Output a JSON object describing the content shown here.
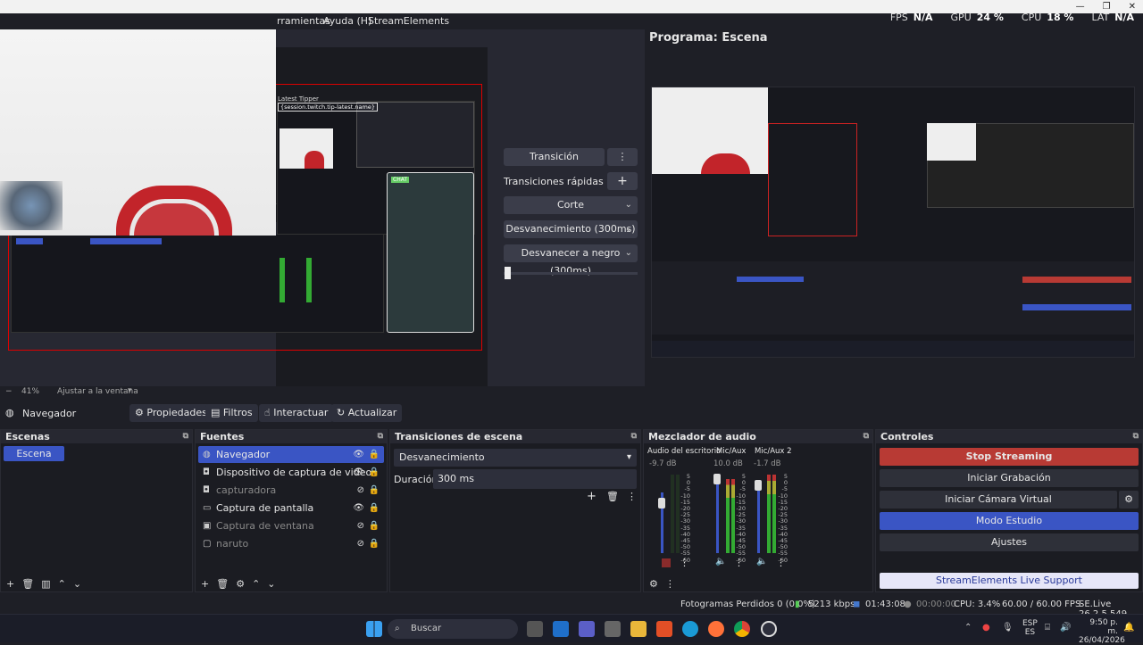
{
  "menu": {
    "items": [
      "rramientas",
      "Ayuda (H)",
      "StreamElements"
    ]
  },
  "stats": {
    "fps_label": "FPS",
    "fps_value": "N/A",
    "gpu_label": "GPU",
    "gpu_value": "24 %",
    "cpu_label": "CPU",
    "cpu_value": "18 %",
    "lat_label": "LAT",
    "lat_value": "N/A"
  },
  "preview": {
    "latest_tipper": "Latest Tipper",
    "tipper_field": "{session.twitch.tip-latest.name}",
    "chat_badge": "CHAT"
  },
  "program": {
    "title": "Programa: Escena"
  },
  "transitions_panel": {
    "transition_button": "Transición",
    "quick_transitions_label": "Transiciones rápidas",
    "add_symbol": "+",
    "options": [
      "Corte",
      "Desvanecimiento (300ms)",
      "Desvanecer a negro (300ms)"
    ]
  },
  "zoom": {
    "minus": "−",
    "value": "41%",
    "fit_label": "Ajustar a la ventana"
  },
  "toolbar": {
    "source_name": "Navegador",
    "properties": "Propiedades",
    "filters": "Filtros",
    "interact": "Interactuar",
    "refresh": "Actualizar"
  },
  "scenes": {
    "title": "Escenas",
    "items": [
      "Escena"
    ]
  },
  "sources": {
    "title": "Fuentes",
    "items": [
      {
        "name": "Navegador",
        "icon": "globe-icon"
      },
      {
        "name": "Dispositivo de captura de video",
        "icon": "camera-icon"
      },
      {
        "name": "capturadora",
        "icon": "camera-icon"
      },
      {
        "name": "Captura de pantalla",
        "icon": "monitor-icon"
      },
      {
        "name": "Captura de ventana",
        "icon": "window-icon"
      },
      {
        "name": "naruto",
        "icon": "media-icon"
      }
    ]
  },
  "scene_transitions": {
    "title": "Transiciones de escena",
    "selected": "Desvanecimiento",
    "duration_label": "Duración",
    "duration_value": "300 ms"
  },
  "mixer": {
    "title": "Mezclador de audio",
    "channels": [
      {
        "name": "Audio del escritorio",
        "db": "-9.7 dB"
      },
      {
        "name": "Mic/Aux",
        "db": "10.0 dB"
      },
      {
        "name": "Mic/Aux 2",
        "db": "-1.7 dB"
      }
    ],
    "ticks": [
      "5",
      "0",
      "-5",
      "-10",
      "-15",
      "-20",
      "-25",
      "-30",
      "-35",
      "-40",
      "-45",
      "-50",
      "-55",
      "-60"
    ]
  },
  "controls": {
    "title": "Controles",
    "stop_streaming": "Stop Streaming",
    "start_recording": "Iniciar Grabación",
    "start_virtual_cam": "Iniciar Cámara Virtual",
    "studio_mode": "Modo Estudio",
    "settings": "Ajustes",
    "support": "StreamElements Live Support"
  },
  "status": {
    "dropped_frames": "Fotogramas Perdidos 0 (0.0%)",
    "bitrate": "5213 kbps",
    "stream_time": "01:43:08",
    "rec_time": "00:00:00",
    "cpu": "CPU: 3.4%",
    "fps": "60.00 / 60.00 FPS",
    "version": "SE.Live 26.2.5.549"
  },
  "taskbar": {
    "search_placeholder": "Buscar",
    "lang_top": "ESP",
    "lang_bottom": "ES",
    "time": "9:50 p. m.",
    "date": "26/04/2026"
  },
  "colors": {
    "accent_blue": "#3a55c4",
    "stop_red": "#b83a34",
    "support_bg": "#e6e6f8"
  }
}
